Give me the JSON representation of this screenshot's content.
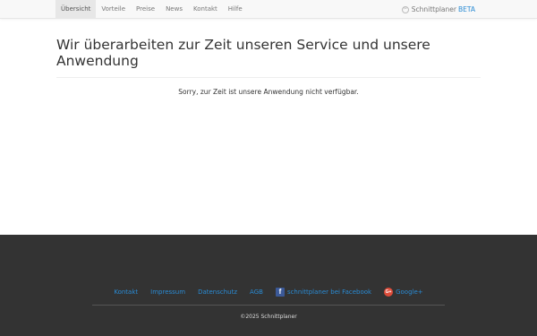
{
  "nav": {
    "items": [
      {
        "label": "Übersicht",
        "active": true
      },
      {
        "label": "Vorteile",
        "active": false
      },
      {
        "label": "Preise",
        "active": false
      },
      {
        "label": "News",
        "active": false
      },
      {
        "label": "Kontakt",
        "active": false
      },
      {
        "label": "Hilfe",
        "active": false
      }
    ],
    "brand": {
      "name": "Schnittplaner",
      "badge": "BETA",
      "icon": "logo-icon"
    }
  },
  "main": {
    "title": "Wir überarbeiten zur Zeit unseren Service und unsere Anwendung",
    "notice": "Sorry, zur Zeit ist unsere Anwendung nicht verfügbar."
  },
  "footer": {
    "links": {
      "kontakt": "Kontakt",
      "impressum": "Impressum",
      "datenschutz": "Datenschutz",
      "agb": "AGB",
      "facebook": "schnittplaner bei Facebook",
      "googleplus": "Google+"
    },
    "icons": {
      "facebook": "facebook-icon",
      "googleplus": "google-plus-icon"
    },
    "copyright": "©2025 Schnittplaner"
  },
  "colors": {
    "accent": "#2a8bd4",
    "navbar_bg": "#f8f8f8",
    "footer_bg": "#333333"
  }
}
